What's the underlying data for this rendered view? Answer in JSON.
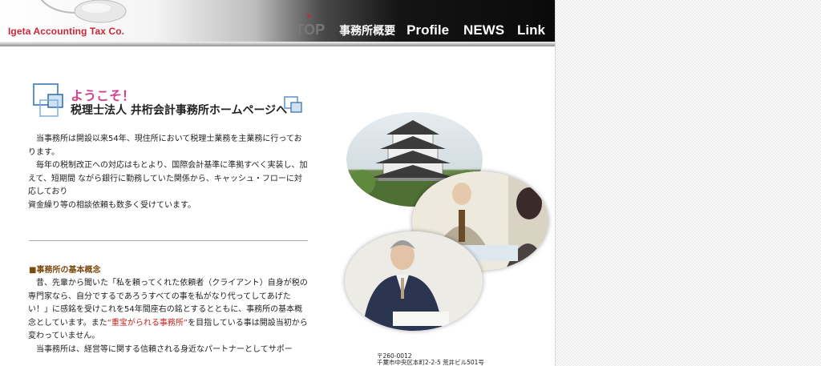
{
  "header": {
    "company_name": "Igeta Accounting Tax Co.",
    "nav": [
      {
        "label": "TOP",
        "active": true
      },
      {
        "label": "事務所概要"
      },
      {
        "label": "Profile"
      },
      {
        "label": "NEWS"
      },
      {
        "label": "Link"
      }
    ],
    "accent_color": "#c9283a"
  },
  "welcome": {
    "line1": "ようこそ！",
    "line2": "税理士法人 井桁会計事務所ホームページへ"
  },
  "intro": {
    "text1": "　当事務所は開設以来54年、現住所において税理士業務を主業務に行っております。",
    "text2": "　毎年の税制改正への対応はもとより、国際会計基準に準拠すべく実装し、加えて、短期間 ながら銀行に勤務していた関係から、キャッシュ・フローに対応しており",
    "text3": "資金繰り等の相談依頼も数多く受けています。"
  },
  "concept": {
    "title": "■事務所の基本概念",
    "text_a": "　昔、先輩から聞いた「私を頼ってくれた依頼者（クライアント）自身が税の専門家なら、自分でするであろうすべての事を私がなり代ってしてあげたい！」に感銘を受けこれを54年間座右の銘とするとともに、事務所の基本概念としています。また",
    "emphasis": "“重宝がられる事務所”",
    "text_b": "を目指している事は開設当初から変わっていません。",
    "text_c": "　当事務所は、経営等に関する信頼される身近なパートナーとしてサポー"
  },
  "address": {
    "postal": "〒260-0012",
    "line": "千葉市中央区本町2-2-5 荒井ビル501号"
  },
  "icons": [
    "computer-mouse-icon",
    "squares-icon",
    "down-arrow-icon"
  ]
}
